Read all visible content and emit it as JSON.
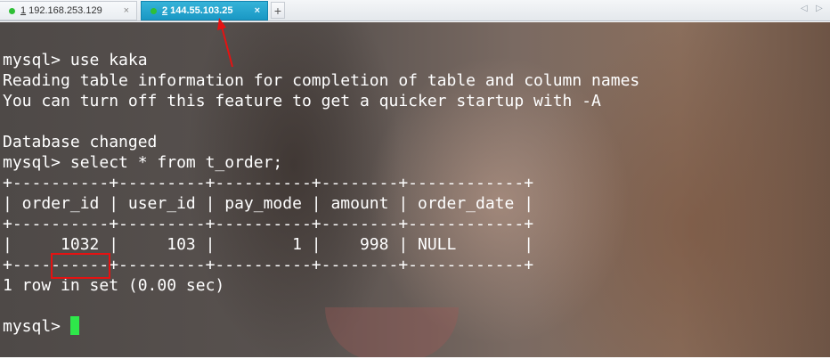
{
  "tabs": [
    {
      "number": "1",
      "host": "192.168.253.129",
      "close": "×",
      "status_color": "#2fbf36",
      "active": false
    },
    {
      "number": "2",
      "host": "144.55.103.25",
      "close": "×",
      "status_color": "#2fbf36",
      "active": true
    }
  ],
  "toolbar": {
    "new_tab": "+",
    "prev": "◁",
    "next": "▷"
  },
  "terminal": {
    "lines": [
      "mysql> use kaka",
      "Reading table information for completion of table and column names",
      "You can turn off this feature to get a quicker startup with -A",
      "",
      "Database changed",
      "mysql> select * from t_order;",
      "+----------+---------+----------+--------+------------+",
      "| order_id | user_id | pay_mode | amount | order_date |",
      "+----------+---------+----------+--------+------------+",
      "|     1032 |     103 |        1 |    998 | NULL       |",
      "+----------+---------+----------+--------+------------+",
      "1 row in set (0.00 sec)",
      "",
      "mysql> "
    ],
    "cursor_color": "#2ee84a"
  },
  "annotations": {
    "highlight_color": "#e51212",
    "highlighted_value": "1032",
    "arrow_color": "#e51212"
  }
}
